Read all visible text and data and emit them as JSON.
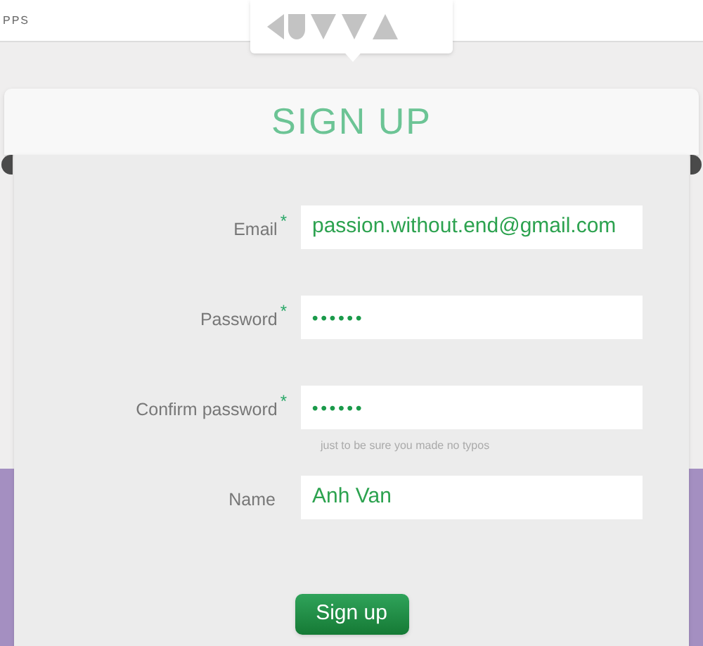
{
  "top_bar": {
    "text": "PPS"
  },
  "form": {
    "title": "SIGN UP",
    "fields": [
      {
        "label": "Email",
        "required": true,
        "kind": "text",
        "value": "passion.without.end@gmail.com"
      },
      {
        "label": "Password",
        "required": true,
        "kind": "password",
        "value": "••••••"
      },
      {
        "label": "Confirm password",
        "required": true,
        "kind": "password",
        "value": "••••••",
        "hint": "just to be sure you made no typos"
      },
      {
        "label": "Name",
        "required": false,
        "kind": "text",
        "value": "Anh Van"
      }
    ],
    "required_mark": "*",
    "submit": "Sign up"
  }
}
